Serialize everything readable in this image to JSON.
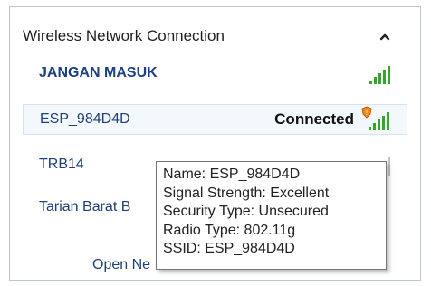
{
  "panel": {
    "title": "Wireless Network Connection",
    "collapse_icon": "chevron-up-icon"
  },
  "networks": [
    {
      "name": "JANGAN MASUK",
      "status": "",
      "signal_bars": 5,
      "signal_color": "#34a829"
    },
    {
      "name": "ESP_984D4D",
      "status": "Connected",
      "signal_bars": 5,
      "signal_color": "#34a829",
      "warning_icon": "shield-warning-icon"
    },
    {
      "name": "TRB14",
      "status": "",
      "signal_bars": 3,
      "signal_color": "#8f8f8f"
    },
    {
      "name": "Tarian Barat B",
      "status": "",
      "signal_bars": 1,
      "signal_color": "#8f8f8f"
    }
  ],
  "footer": {
    "open_link": "Open Ne"
  },
  "tooltip": {
    "lines": [
      "Name: ESP_984D4D",
      "Signal Strength: Excellent",
      "Security Type: Unsecured",
      "Radio Type: 802.11g",
      "SSID: ESP_984D4D"
    ]
  },
  "colors": {
    "accent": "#1c3f88",
    "signal_green": "#34a829",
    "selection_bg": "#f3f8fd"
  }
}
